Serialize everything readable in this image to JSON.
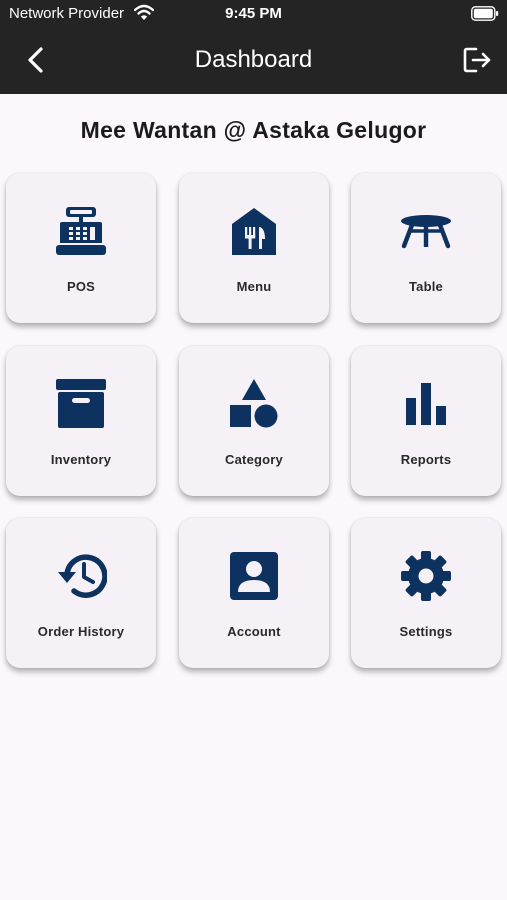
{
  "status_bar": {
    "carrier": "Network Provider",
    "time": "9:45 PM",
    "wifi_icon": "wifi-icon",
    "battery_icon": "battery-icon"
  },
  "app_bar": {
    "title": "Dashboard",
    "back_icon": "chevron-left-icon",
    "logout_icon": "logout-icon"
  },
  "store_name": "Mee Wantan @ Astaka Gelugor",
  "colors": {
    "app_bar_bg": "#242424",
    "icon_navy": "#0d3260",
    "page_bg": "#fbf7fb",
    "tile_bg": "#f5f1f6"
  },
  "tiles": [
    {
      "label": "POS",
      "icon": "cash-register-icon"
    },
    {
      "label": "Menu",
      "icon": "restaurant-menu-icon"
    },
    {
      "label": "Table",
      "icon": "table-icon"
    },
    {
      "label": "Inventory",
      "icon": "inventory-box-icon"
    },
    {
      "label": "Category",
      "icon": "category-shapes-icon"
    },
    {
      "label": "Reports",
      "icon": "bar-chart-icon"
    },
    {
      "label": "Order History",
      "icon": "history-icon"
    },
    {
      "label": "Account",
      "icon": "account-box-icon"
    },
    {
      "label": "Settings",
      "icon": "gear-icon"
    }
  ]
}
